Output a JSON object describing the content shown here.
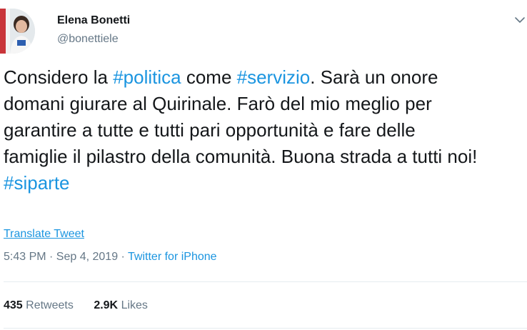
{
  "user": {
    "name": "Elena Bonetti",
    "handle": "@bonettiele"
  },
  "tweet": {
    "lines": [
      [
        {
          "text": "Considero la ",
          "type": "text"
        },
        {
          "text": "#politica",
          "type": "hashtag"
        },
        {
          "text": " come ",
          "type": "text"
        },
        {
          "text": "#servizio",
          "type": "hashtag"
        },
        {
          "text": ". Sarà un onore",
          "type": "text"
        }
      ],
      [
        {
          "text": "domani giurare al Quirinale. Farò del mio meglio per",
          "type": "text"
        }
      ],
      [
        {
          "text": "garantire a tutte e tutti pari opportunità e fare delle",
          "type": "text"
        }
      ],
      [
        {
          "text": "famiglie il pilastro della comunità. Buona strada a tutti noi!",
          "type": "text"
        }
      ],
      [
        {
          "text": "#siparte",
          "type": "hashtag"
        }
      ]
    ],
    "translate_label": "Translate Tweet",
    "time": "5:43 PM · Sep 4, 2019 · ",
    "source": "Twitter for iPhone"
  },
  "stats": {
    "retweets_count": "435",
    "retweets_label": "Retweets",
    "likes_count": "2.9K",
    "likes_label": "Likes"
  },
  "icons": {
    "more": "chevron-down-icon"
  },
  "colors": {
    "link": "#1b95e0",
    "text": "#14171a",
    "muted": "#657786",
    "divider": "#e6ecf0"
  }
}
